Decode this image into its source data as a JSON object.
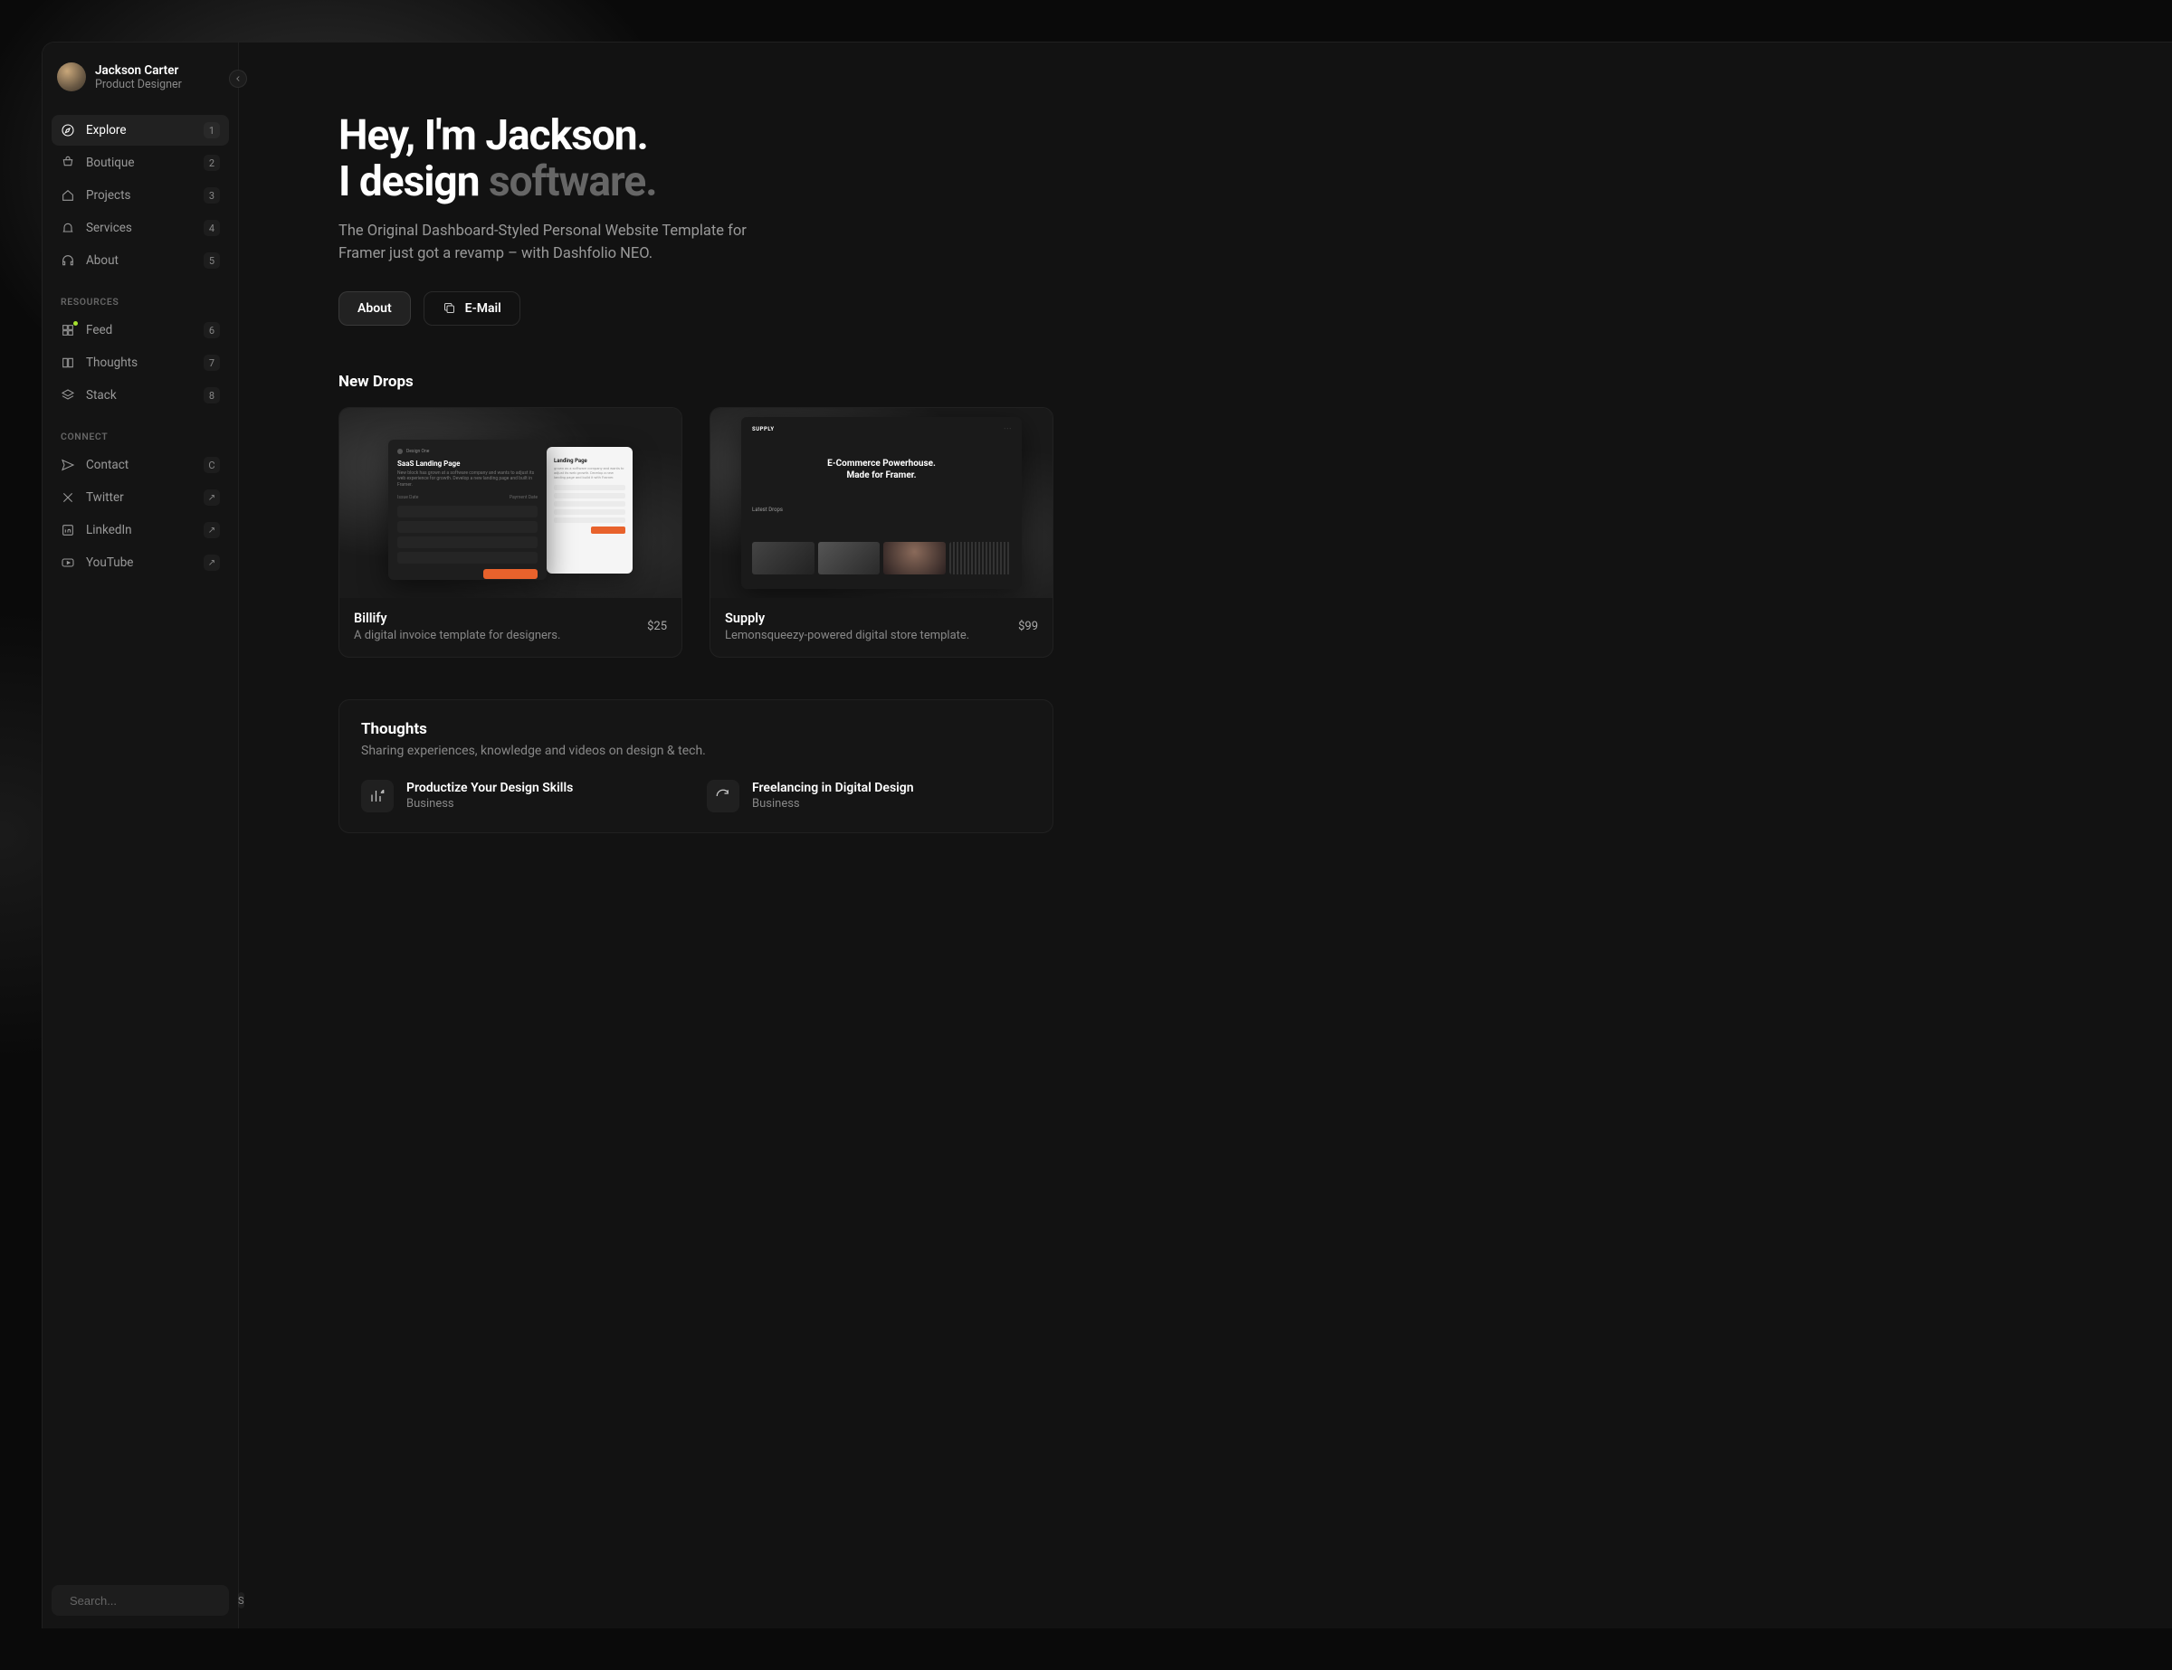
{
  "profile": {
    "name": "Jackson Carter",
    "role": "Product Designer"
  },
  "nav": {
    "primary": [
      {
        "label": "Explore",
        "badge": "1"
      },
      {
        "label": "Boutique",
        "badge": "2"
      },
      {
        "label": "Projects",
        "badge": "3"
      },
      {
        "label": "Services",
        "badge": "4"
      },
      {
        "label": "About",
        "badge": "5"
      }
    ],
    "resources_header": "RESOURCES",
    "resources": [
      {
        "label": "Feed",
        "badge": "6"
      },
      {
        "label": "Thoughts",
        "badge": "7"
      },
      {
        "label": "Stack",
        "badge": "8"
      }
    ],
    "connect_header": "CONNECT",
    "connect": [
      {
        "label": "Contact",
        "badge": "C"
      },
      {
        "label": "Twitter",
        "badge": "↗"
      },
      {
        "label": "LinkedIn",
        "badge": "↗"
      },
      {
        "label": "YouTube",
        "badge": "↗"
      }
    ]
  },
  "search": {
    "placeholder": "Search...",
    "key": "S"
  },
  "hero": {
    "line1": "Hey, I'm Jackson.",
    "line2a": "I design ",
    "line2b": "software.",
    "sub": "The Original Dashboard-Styled Personal Website Template for Framer just got a revamp – with Dashfolio NEO.",
    "about_btn": "About",
    "email_btn": "E-Mail"
  },
  "drops": {
    "title": "New Drops",
    "items": [
      {
        "title": "Billify",
        "desc": "A digital invoice template for designers.",
        "price": "$25"
      },
      {
        "title": "Supply",
        "desc": "Lemonsqueezy-powered digital store template.",
        "price": "$99"
      }
    ]
  },
  "mockup1": {
    "heading": "SaaS Landing Page",
    "light_heading": "Landing Page"
  },
  "mockup2": {
    "brand": "SUPPLY",
    "hero_line1": "E-Commerce Powerhouse.",
    "hero_line2": "Made for Framer.",
    "latest": "Latest Drops"
  },
  "thoughts": {
    "title": "Thoughts",
    "sub": "Sharing experiences, knowledge and videos on design & tech.",
    "items": [
      {
        "title": "Productize Your Design Skills",
        "cat": "Business"
      },
      {
        "title": "Freelancing in Digital Design",
        "cat": "Business"
      }
    ]
  }
}
